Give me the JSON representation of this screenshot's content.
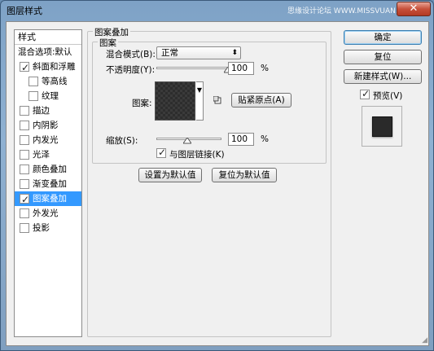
{
  "window": {
    "title": "图层样式",
    "watermark": "思缘设计论坛 WWW.MISSVUAN.COM",
    "close_glyph": "✕"
  },
  "styles_panel": {
    "header": "样式",
    "items": [
      {
        "label": "混合选项:默认",
        "checkbox": false,
        "checked": false,
        "selected": false
      },
      {
        "label": "斜面和浮雕",
        "checkbox": true,
        "checked": true,
        "selected": false
      },
      {
        "label": "等高线",
        "checkbox": true,
        "checked": false,
        "selected": false,
        "sub": true
      },
      {
        "label": "纹理",
        "checkbox": true,
        "checked": false,
        "selected": false,
        "sub": true
      },
      {
        "label": "描边",
        "checkbox": true,
        "checked": false,
        "selected": false
      },
      {
        "label": "内阴影",
        "checkbox": true,
        "checked": false,
        "selected": false
      },
      {
        "label": "内发光",
        "checkbox": true,
        "checked": false,
        "selected": false
      },
      {
        "label": "光泽",
        "checkbox": true,
        "checked": false,
        "selected": false
      },
      {
        "label": "颜色叠加",
        "checkbox": true,
        "checked": false,
        "selected": false
      },
      {
        "label": "渐变叠加",
        "checkbox": true,
        "checked": false,
        "selected": false
      },
      {
        "label": "图案叠加",
        "checkbox": true,
        "checked": true,
        "selected": true
      },
      {
        "label": "外发光",
        "checkbox": true,
        "checked": false,
        "selected": false
      },
      {
        "label": "投影",
        "checkbox": true,
        "checked": false,
        "selected": false
      }
    ]
  },
  "pattern_overlay": {
    "group_title": "图案叠加",
    "inner_group_title": "图案",
    "blend_mode_label": "混合模式(B):",
    "blend_mode_value": "正常",
    "opacity_label": "不透明度(Y):",
    "opacity_value": "100",
    "opacity_unit": "%",
    "opacity_level": 1.0,
    "pattern_label": "图案:",
    "snap_origin_button": "贴紧原点(A)",
    "scale_label": "缩放(S):",
    "scale_value": "100",
    "scale_unit": "%",
    "link_layer_label": "与图层链接(K)",
    "link_layer_checked": true,
    "make_default_button": "设置为默认值",
    "reset_default_button": "复位为默认值"
  },
  "right_buttons": {
    "ok": "确定",
    "reset": "复位",
    "new_style": "新建样式(W)...",
    "preview_label": "预览(V)",
    "preview_checked": true
  },
  "colors": {
    "selection": "#3399ff",
    "pattern_dark": "#2d2d2d"
  }
}
